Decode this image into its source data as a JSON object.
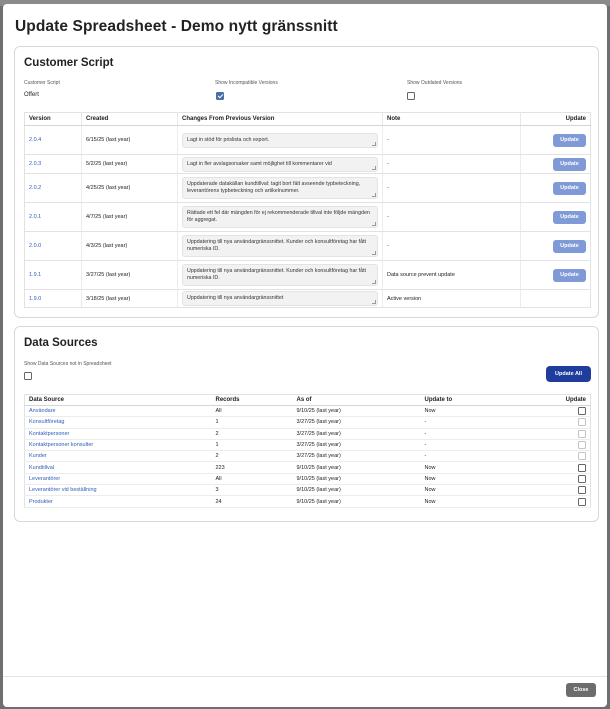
{
  "modal": {
    "title": "Update Spreadsheet - Demo nytt gränssnitt",
    "close_label": "Close"
  },
  "customer_script": {
    "title": "Customer Script",
    "script_label": "Customer Script",
    "script_value": "Offert",
    "incompatible_label": "Show Incompatible Versions",
    "incompatible_checked": true,
    "outdated_label": "Show Outdated Versions",
    "outdated_checked": false,
    "columns": [
      "Version",
      "Created",
      "Changes From Previous Version",
      "Note",
      "Update"
    ],
    "rows": [
      {
        "version": "2.0.4",
        "created": "6/15/25 (last year)",
        "changes": "Lagt in stöd för prislista och export.",
        "note": "-",
        "update": "Update"
      },
      {
        "version": "2.0.3",
        "created": "5/2/25 (last year)",
        "changes": "Lagt in fler avslagsorsaker samt möjlighet till kommentarer vid",
        "note": "-",
        "update": "Update"
      },
      {
        "version": "2.0.2",
        "created": "4/25/25 (last year)",
        "changes": "Uppdaterade datakällan kundtillval: tagit bort fält avseende typbeteckning, leverantörens typbeteckning och artikelnummer.",
        "note": "-",
        "update": "Update"
      },
      {
        "version": "2.0.1",
        "created": "4/7/25 (last year)",
        "changes": "Rättade ett fel där mängden för ej rekommenderade tillval inte följde mängden för aggregat.",
        "note": "-",
        "update": "Update"
      },
      {
        "version": "2.0.0",
        "created": "4/3/25 (last year)",
        "changes": "Uppdatering till nya användargränssnittet. Kunder och konsultföretag har fått numeriska ID.",
        "note": "-",
        "update": "Update"
      },
      {
        "version": "1.9.1",
        "created": "3/27/25 (last year)",
        "changes": "Uppdatering till nya användargränssnittet. Kunder och konsultföretag har fått numeriska ID.",
        "note": "Data source prevent update",
        "update": "Update"
      },
      {
        "version": "1.9.0",
        "created": "3/18/25 (last year)",
        "changes": "Uppdatering till nya användargränssnittet",
        "note": "Active version",
        "update": ""
      }
    ]
  },
  "data_sources": {
    "title": "Data Sources",
    "show_not_in_label": "Show Data Sources not in Spreadsheet",
    "show_not_in_checked": false,
    "update_all_label": "Update All",
    "columns": [
      "Data Source",
      "Records",
      "As of",
      "Update to",
      "Update"
    ],
    "rows": [
      {
        "name": "Användare",
        "records": "All",
        "as_of": "9/10/25 (last year)",
        "update_to": "Now",
        "enabled": true
      },
      {
        "name": "Konsultföretag",
        "records": "1",
        "as_of": "3/27/25 (last year)",
        "update_to": "-",
        "enabled": false
      },
      {
        "name": "Kontaktpersoner",
        "records": "2",
        "as_of": "3/27/25 (last year)",
        "update_to": "-",
        "enabled": false
      },
      {
        "name": "Kontaktpersoner konsulter",
        "records": "1",
        "as_of": "3/27/25 (last year)",
        "update_to": "-",
        "enabled": false
      },
      {
        "name": "Kunder",
        "records": "2",
        "as_of": "3/27/25 (last year)",
        "update_to": "-",
        "enabled": false
      },
      {
        "name": "Kundtillval",
        "records": "223",
        "as_of": "9/10/25 (last year)",
        "update_to": "Now",
        "enabled": true
      },
      {
        "name": "Leverantörer",
        "records": "All",
        "as_of": "9/10/25 (last year)",
        "update_to": "Now",
        "enabled": true
      },
      {
        "name": "Leverantörer vid beställning",
        "records": "3",
        "as_of": "9/10/25 (last year)",
        "update_to": "Now",
        "enabled": true
      },
      {
        "name": "Produkter",
        "records": "24",
        "as_of": "9/10/25 (last year)",
        "update_to": "Now",
        "enabled": true
      }
    ]
  }
}
